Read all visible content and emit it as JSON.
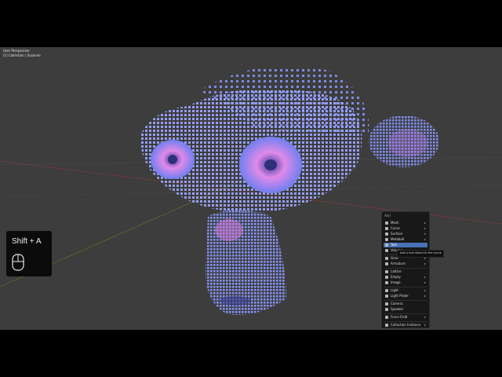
{
  "viewport": {
    "view_name": "User Perspective",
    "collection_info": "(1) Collection | Suzanne"
  },
  "key_hint": {
    "keys": "Shift + A",
    "icon": "mouse-icon"
  },
  "add_menu": {
    "title": "Add",
    "items": [
      {
        "label": "Mesh",
        "submenu": true
      },
      {
        "label": "Curve",
        "submenu": true
      },
      {
        "label": "Surface",
        "submenu": true
      },
      {
        "label": "Metaball",
        "submenu": true
      },
      {
        "label": "Text",
        "submenu": false,
        "active": true
      },
      {
        "label": "Volume",
        "submenu": true
      },
      {
        "label": "Grea",
        "submenu": true
      },
      {
        "label": "Armature",
        "submenu": true
      },
      {
        "label": "Lattice",
        "submenu": false
      },
      {
        "label": "Empty",
        "submenu": true
      },
      {
        "label": "Image",
        "submenu": true
      },
      {
        "label": "Light",
        "submenu": true
      },
      {
        "label": "Light Probe",
        "submenu": true
      },
      {
        "label": "Camera",
        "submenu": false
      },
      {
        "label": "Speaker",
        "submenu": false
      },
      {
        "label": "Force Field",
        "submenu": true
      },
      {
        "label": "Collection Instance",
        "submenu": true
      }
    ],
    "submenu_arrow": "▸",
    "tooltip": "Add a text object to the scene"
  },
  "colors": {
    "viewport_bg": "#3d3d3d",
    "accent": "#4772b3",
    "model_primary": "#7f8cf5",
    "model_highlight": "#d77be0"
  }
}
